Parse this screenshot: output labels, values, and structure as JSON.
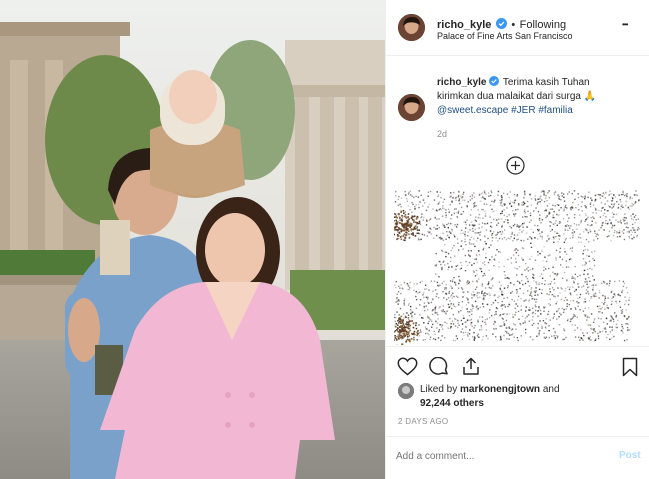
{
  "post": {
    "username": "richo_kyle",
    "follow_status": "Following",
    "location": "Palace of Fine Arts San Francisco",
    "caption": {
      "username": "richo_kyle",
      "line1": "Terima kasih Tuhan",
      "line2": "kirimkan dua malaikat dari surga",
      "emoji": "🙏",
      "mention": "@sweet.escape",
      "hashtag1": "#JER",
      "hashtag2": "#familia",
      "age": "2d"
    },
    "likes": {
      "prefix": "Liked by",
      "user": "markonengjtown",
      "and": "and",
      "count": "92,244 others"
    },
    "timestamp": "2 DAYS AGO",
    "comment_placeholder": "Add a comment...",
    "post_button": "Post",
    "bullet": "•",
    "more_glyph": "•••"
  },
  "colors": {
    "verified": "#3897f0",
    "link": "#1f4f7f",
    "post_disabled": "#b2dffc",
    "jacket": "#f2b8d3"
  }
}
